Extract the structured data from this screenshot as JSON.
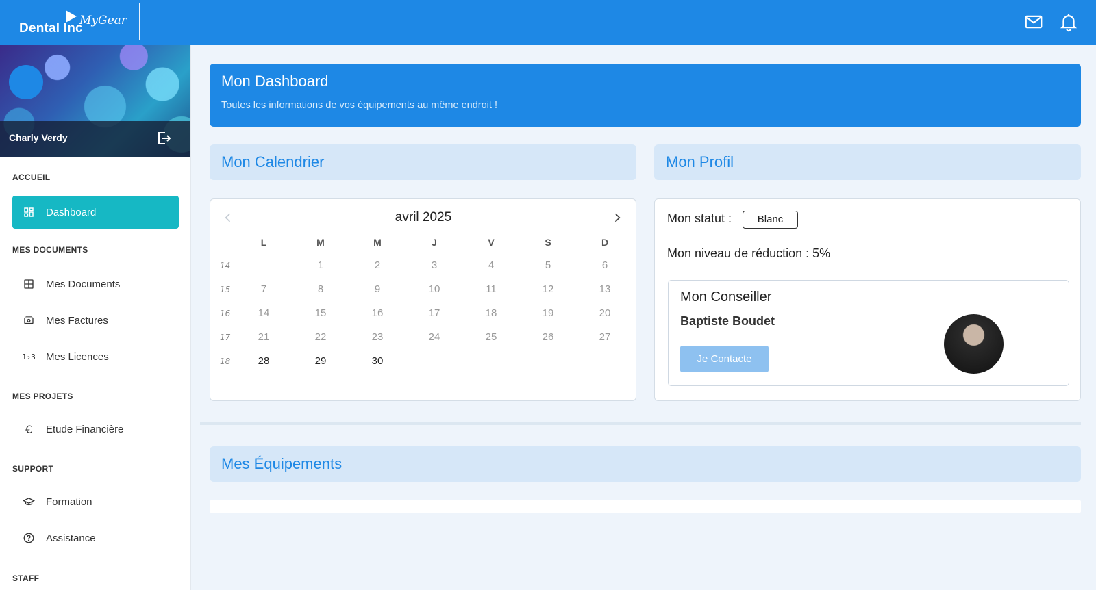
{
  "brand": {
    "name": "Dental Inc",
    "sub": "MyGear"
  },
  "user": {
    "name": "Charly Verdy"
  },
  "nav": {
    "sections": [
      {
        "title": "ACCUEIL"
      },
      {
        "title": "MES DOCUMENTS"
      },
      {
        "title": "MES PROJETS"
      },
      {
        "title": "SUPPORT"
      },
      {
        "title": "STAFF"
      }
    ],
    "items": [
      {
        "label": "Dashboard",
        "icon": "dashboard-icon",
        "active": true
      },
      {
        "label": "Mes Documents",
        "icon": "grid-icon"
      },
      {
        "label": "Mes Factures",
        "icon": "invoice-icon"
      },
      {
        "label": "Mes Licences",
        "icon": "numbers-icon"
      },
      {
        "label": "Etude Financière",
        "icon": "euro-icon"
      },
      {
        "label": "Formation",
        "icon": "graduation-cap-icon"
      },
      {
        "label": "Assistance",
        "icon": "help-circle-icon"
      }
    ]
  },
  "hero": {
    "title": "Mon Dashboard",
    "subtitle": "Toutes les informations de vos équipements au même endroit !"
  },
  "calendar": {
    "title": "Mon Calendrier",
    "month": "avril 2025",
    "dow": [
      "L",
      "M",
      "M",
      "J",
      "V",
      "S",
      "D"
    ],
    "weeks": [
      "14",
      "15",
      "16",
      "17",
      "18"
    ],
    "rows": [
      [
        "",
        "1",
        "2",
        "3",
        "4",
        "5",
        "6"
      ],
      [
        "7",
        "8",
        "9",
        "10",
        "11",
        "12",
        "13"
      ],
      [
        "14",
        "15",
        "16",
        "17",
        "18",
        "19",
        "20"
      ],
      [
        "21",
        "22",
        "23",
        "24",
        "25",
        "26",
        "27"
      ],
      [
        "28",
        "29",
        "30",
        "",
        "",
        "",
        ""
      ]
    ]
  },
  "profile": {
    "title": "Mon Profil",
    "status_label": "Mon statut :",
    "status_value": "Blanc",
    "reduction_label": "Mon niveau de réduction : 5%",
    "advisor": {
      "title": "Mon Conseiller",
      "name": "Baptiste Boudet",
      "contact_label": "Je Contacte"
    }
  },
  "equipment": {
    "title": "Mes Équipements"
  },
  "colors": {
    "primary": "#1e88e5",
    "accent": "#16b8c4",
    "section_bg": "#d6e7f8"
  }
}
